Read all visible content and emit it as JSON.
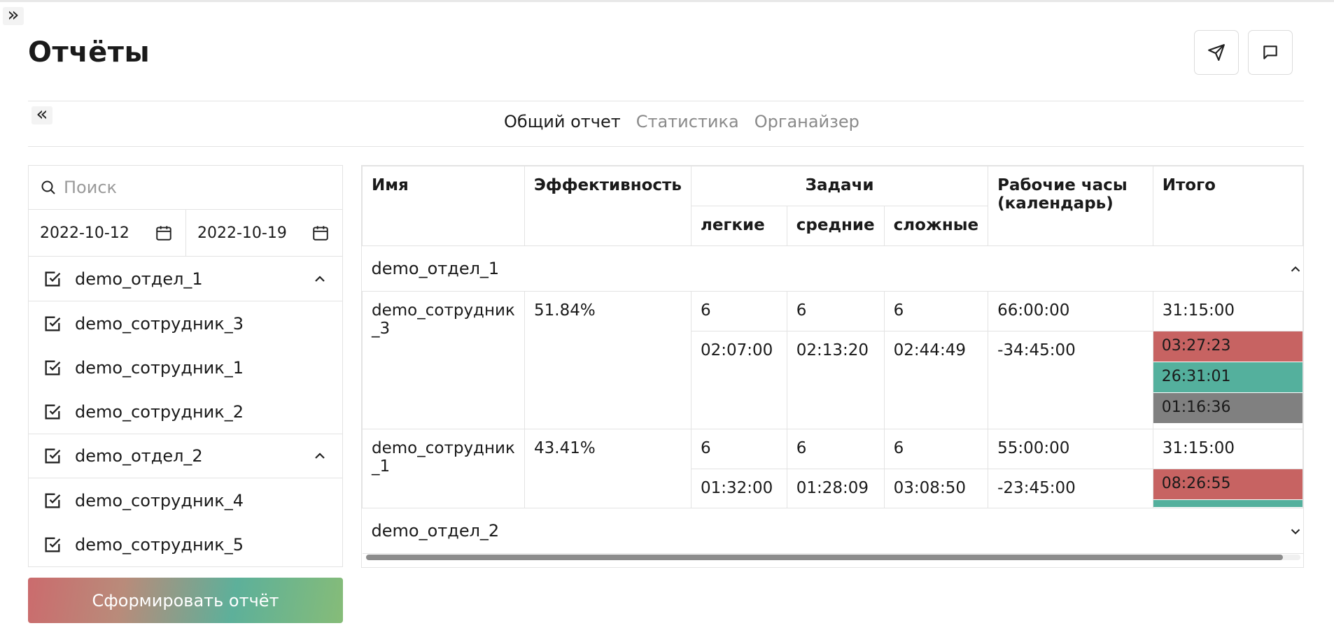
{
  "page": {
    "title": "Отчёты"
  },
  "tabs": [
    {
      "label": "Общий отчет",
      "active": true
    },
    {
      "label": "Статистика",
      "active": false
    },
    {
      "label": "Органайзер",
      "active": false
    }
  ],
  "filter": {
    "search_placeholder": "Поиск",
    "date_from": "2022-10-12",
    "date_to": "2022-10-19",
    "tree": [
      {
        "label": "demo_отдел_1",
        "type": "group",
        "expanded": true
      },
      {
        "label": "demo_сотрудник_3",
        "type": "item"
      },
      {
        "label": "demo_сотрудник_1",
        "type": "item"
      },
      {
        "label": "demo_сотрудник_2",
        "type": "item"
      },
      {
        "label": "demo_отдел_2",
        "type": "group",
        "expanded": true
      },
      {
        "label": "demo_сотрудник_4",
        "type": "item"
      },
      {
        "label": "demo_сотрудник_5",
        "type": "item"
      }
    ],
    "submit_label": "Сформировать отчёт"
  },
  "table": {
    "headers": {
      "name": "Имя",
      "efficiency": "Эффективность",
      "tasks": "Задачи",
      "easy": "легкие",
      "medium": "средние",
      "hard": "сложные",
      "hours": "Рабочие часы (календарь)",
      "total": "Итого"
    },
    "groups": [
      {
        "name": "demo_отдел_1",
        "expanded": true,
        "rows": [
          {
            "name": "demo_сотрудник_3",
            "efficiency": "51.84%",
            "counts": [
              "6",
              "6",
              "6"
            ],
            "times": [
              "02:07:00",
              "02:13:20",
              "02:44:49"
            ],
            "hours_plan": "66:00:00",
            "hours_diff": "-34:45:00",
            "total": "31:15:00",
            "breakdown": [
              {
                "value": "03:27:23",
                "color": "#c76362"
              },
              {
                "value": "26:31:01",
                "color": "#54b09d"
              },
              {
                "value": "01:16:36",
                "color": "#808080"
              }
            ]
          },
          {
            "name": "demo_сотрудник_1",
            "efficiency": "43.41%",
            "counts": [
              "6",
              "6",
              "6"
            ],
            "times": [
              "01:32:00",
              "01:28:09",
              "03:08:50"
            ],
            "hours_plan": "55:00:00",
            "hours_diff": "-23:45:00",
            "total": "31:15:00",
            "breakdown": [
              {
                "value": "08:26:55",
                "color": "#c76362"
              }
            ]
          }
        ]
      },
      {
        "name": "demo_отдел_2",
        "expanded": false
      }
    ]
  }
}
